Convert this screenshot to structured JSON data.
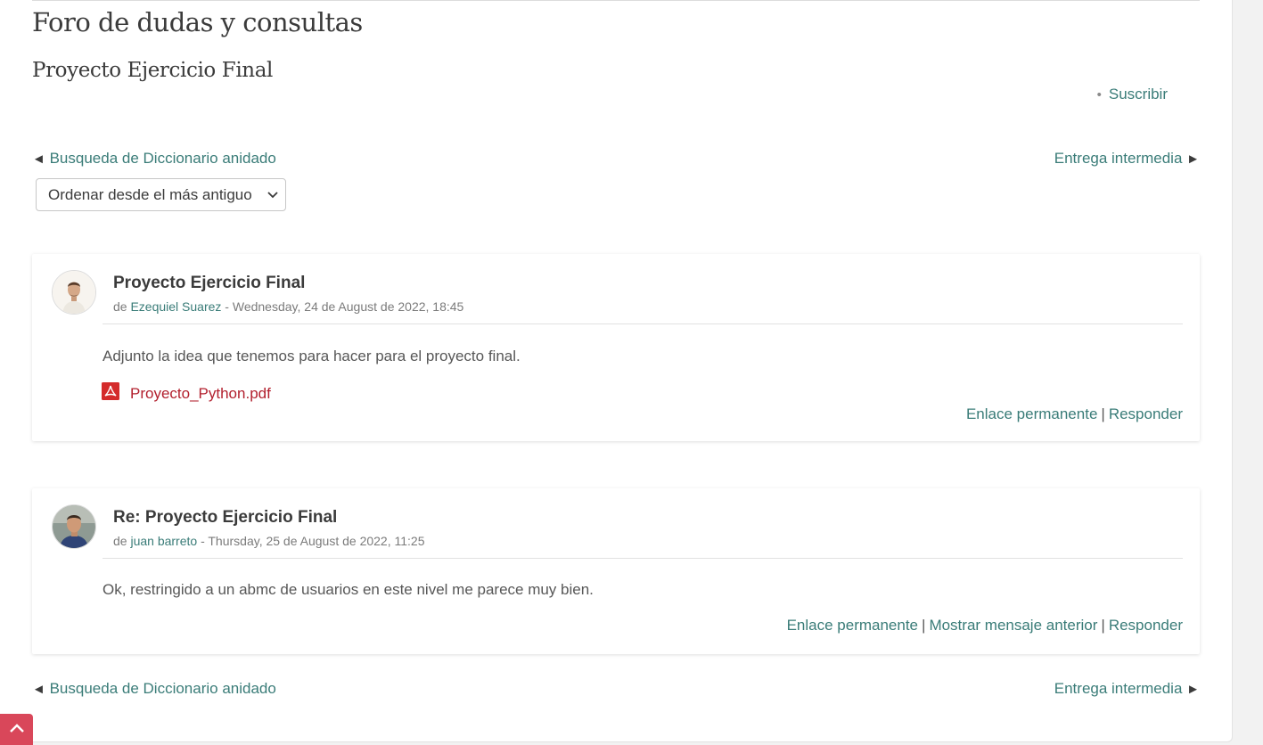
{
  "forum": {
    "title": "Foro de dudas y consultas",
    "discussion_title": "Proyecto Ejercicio Final",
    "subscribe_label": "Suscribir"
  },
  "navigation": {
    "prev_label": "Busqueda de Diccionario anidado",
    "next_label": "Entrega intermedia",
    "prev_arrow": "◄",
    "next_arrow": "►"
  },
  "sort": {
    "selected": "Ordenar desde el más antiguo"
  },
  "posts": [
    {
      "subject": "Proyecto Ejercicio Final",
      "by_prefix": "de",
      "author": "Ezequiel Suarez",
      "date": " - Wednesday, 24 de August de 2022, 18:45",
      "body": "Adjunto la idea que tenemos para hacer para el proyecto final.",
      "attachment": "Proyecto_Python.pdf",
      "actions": {
        "permalink": "Enlace permanente",
        "reply": "Responder"
      }
    },
    {
      "subject": "Re: Proyecto Ejercicio Final",
      "by_prefix": "de",
      "author": "juan barreto",
      "date": " - Thursday, 25 de August de 2022, 11:25",
      "body": "Ok, restringido a un abmc de usuarios en este nivel me parece muy bien.",
      "actions": {
        "permalink": "Enlace permanente",
        "show_parent": "Mostrar mensaje anterior",
        "reply": "Responder"
      }
    }
  ],
  "colors": {
    "link": "#3a7c78",
    "attachment": "#b21f2d",
    "scroll_top_bg": "#d9475a"
  },
  "icons": {
    "pdf": "pdf-icon",
    "scroll_top": "chevron-up-icon",
    "select": "chevron-down-icon"
  }
}
